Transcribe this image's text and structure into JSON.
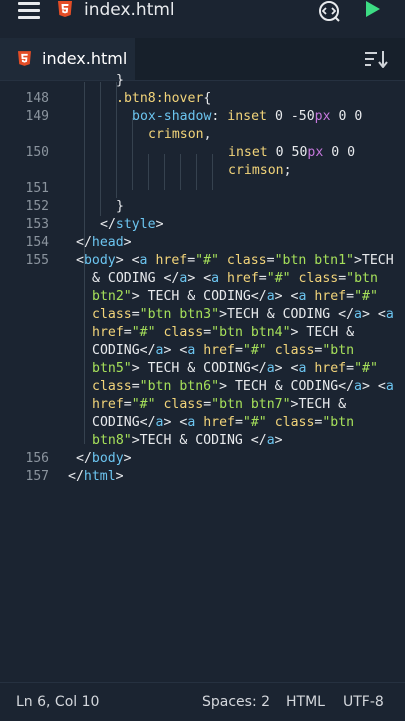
{
  "header": {
    "file_title": "index.html",
    "icons": [
      "menu-icon",
      "html5-icon",
      "debug-icon",
      "run-icon"
    ]
  },
  "tabs": [
    {
      "label": "index.html",
      "active": true
    }
  ],
  "editor": {
    "lines": [
      {
        "n": "",
        "segs": [
          [
            "p",
            "}"
          ]
        ]
      },
      {
        "n": "148",
        "segs": [
          [
            "sel",
            ".btn8:hover"
          ],
          [
            "p",
            "{"
          ]
        ]
      },
      {
        "n": "149",
        "segs": [
          [
            "prop",
            "box-shadow"
          ],
          [
            "p",
            ": "
          ],
          [
            "a",
            "inset "
          ],
          [
            "num",
            "0 -50"
          ],
          [
            "unit",
            "px"
          ],
          [
            "num",
            " 0 0"
          ]
        ]
      },
      {
        "n": "",
        "segs": [
          [
            "a",
            "crimson"
          ],
          [
            "p",
            ","
          ]
        ]
      },
      {
        "n": "150",
        "segs": [
          [
            "a",
            "inset "
          ],
          [
            "num",
            "0 50"
          ],
          [
            "unit",
            "px"
          ],
          [
            "num",
            " 0 0"
          ]
        ]
      },
      {
        "n": "",
        "segs": [
          [
            "a",
            "crimson"
          ],
          [
            "p",
            ";"
          ]
        ]
      },
      {
        "n": "151",
        "segs": []
      },
      {
        "n": "152",
        "segs": [
          [
            "p",
            "}"
          ]
        ]
      },
      {
        "n": "153",
        "segs": [
          [
            "p",
            "</"
          ],
          [
            "t",
            "style"
          ],
          [
            "p",
            ">"
          ]
        ]
      },
      {
        "n": "154",
        "segs": [
          [
            "p",
            "</"
          ],
          [
            "t",
            "head"
          ],
          [
            "p",
            ">"
          ]
        ]
      },
      {
        "n": "155",
        "segs": [
          [
            "p",
            "<"
          ],
          [
            "t",
            "body"
          ],
          [
            "p",
            "> <"
          ],
          [
            "t",
            "a "
          ],
          [
            "a",
            "href"
          ],
          [
            "p",
            "="
          ],
          [
            "s",
            "\"#\""
          ],
          [
            "a",
            " class"
          ],
          [
            "p",
            "="
          ],
          [
            "s",
            "\"btn btn1\""
          ],
          [
            "p",
            ">TECH"
          ]
        ]
      },
      {
        "n": "",
        "segs": [
          [
            "w",
            "& CODING "
          ],
          [
            "p",
            "</"
          ],
          [
            "t",
            "a"
          ],
          [
            "p",
            "> <"
          ],
          [
            "t",
            "a "
          ],
          [
            "a",
            "href"
          ],
          [
            "p",
            "="
          ],
          [
            "s",
            "\"#\""
          ],
          [
            "a",
            " class"
          ],
          [
            "p",
            "="
          ],
          [
            "s",
            "\"btn"
          ]
        ]
      },
      {
        "n": "",
        "segs": [
          [
            "s",
            "btn2\""
          ],
          [
            "p",
            "> TECH & CODING</"
          ],
          [
            "t",
            "a"
          ],
          [
            "p",
            "> <"
          ],
          [
            "t",
            "a "
          ],
          [
            "a",
            "href"
          ],
          [
            "p",
            "="
          ],
          [
            "s",
            "\"#\""
          ]
        ]
      },
      {
        "n": "",
        "segs": [
          [
            "a",
            "class"
          ],
          [
            "p",
            "="
          ],
          [
            "s",
            "\"btn btn3\""
          ],
          [
            "p",
            ">TECH & CODING </"
          ],
          [
            "t",
            "a"
          ],
          [
            "p",
            "> <"
          ],
          [
            "t",
            "a"
          ]
        ]
      },
      {
        "n": "",
        "segs": [
          [
            "a",
            "href"
          ],
          [
            "p",
            "="
          ],
          [
            "s",
            "\"#\""
          ],
          [
            "a",
            " class"
          ],
          [
            "p",
            "="
          ],
          [
            "s",
            "\"btn btn4\""
          ],
          [
            "p",
            "> TECH &"
          ]
        ]
      },
      {
        "n": "",
        "segs": [
          [
            "w",
            "CODING"
          ],
          [
            "p",
            "</"
          ],
          [
            "t",
            "a"
          ],
          [
            "p",
            "> <"
          ],
          [
            "t",
            "a "
          ],
          [
            "a",
            "href"
          ],
          [
            "p",
            "="
          ],
          [
            "s",
            "\"#\""
          ],
          [
            "a",
            " class"
          ],
          [
            "p",
            "="
          ],
          [
            "s",
            "\"btn"
          ]
        ]
      },
      {
        "n": "",
        "segs": [
          [
            "s",
            "btn5\""
          ],
          [
            "p",
            "> TECH & CODING</"
          ],
          [
            "t",
            "a"
          ],
          [
            "p",
            "> <"
          ],
          [
            "t",
            "a "
          ],
          [
            "a",
            "href"
          ],
          [
            "p",
            "="
          ],
          [
            "s",
            "\"#\""
          ]
        ]
      },
      {
        "n": "",
        "segs": [
          [
            "a",
            "class"
          ],
          [
            "p",
            "="
          ],
          [
            "s",
            "\"btn btn6\""
          ],
          [
            "p",
            "> TECH & CODING</"
          ],
          [
            "t",
            "a"
          ],
          [
            "p",
            "> <"
          ],
          [
            "t",
            "a"
          ]
        ]
      },
      {
        "n": "",
        "segs": [
          [
            "a",
            "href"
          ],
          [
            "p",
            "="
          ],
          [
            "s",
            "\"#\""
          ],
          [
            "a",
            " class"
          ],
          [
            "p",
            "="
          ],
          [
            "s",
            "\"btn btn7\""
          ],
          [
            "p",
            ">TECH &"
          ]
        ]
      },
      {
        "n": "",
        "segs": [
          [
            "w",
            "CODING"
          ],
          [
            "p",
            "</"
          ],
          [
            "t",
            "a"
          ],
          [
            "p",
            "> <"
          ],
          [
            "t",
            "a "
          ],
          [
            "a",
            "href"
          ],
          [
            "p",
            "="
          ],
          [
            "s",
            "\"#\""
          ],
          [
            "a",
            " class"
          ],
          [
            "p",
            "="
          ],
          [
            "s",
            "\"btn"
          ]
        ]
      },
      {
        "n": "",
        "segs": [
          [
            "s",
            "btn8\""
          ],
          [
            "p",
            ">TECH & CODING </"
          ],
          [
            "t",
            "a"
          ],
          [
            "p",
            ">"
          ]
        ]
      },
      {
        "n": "156",
        "segs": [
          [
            "p",
            "</"
          ],
          [
            "t",
            "body"
          ],
          [
            "p",
            ">"
          ]
        ]
      },
      {
        "n": "157",
        "segs": [
          [
            "p",
            "</"
          ],
          [
            "t",
            "html"
          ],
          [
            "p",
            ">"
          ]
        ]
      }
    ]
  },
  "status": {
    "position": "Ln 6, Col 10",
    "spaces": "Spaces: 2",
    "language": "HTML",
    "encoding": "UTF-8"
  },
  "colors": {
    "background": "#1b2431",
    "tag": "#6cc5f0",
    "attribute": "#f2d47a",
    "string": "#a6e05a",
    "unit": "#c678dd",
    "run": "#3ddc84",
    "html5": "#e44d26"
  }
}
